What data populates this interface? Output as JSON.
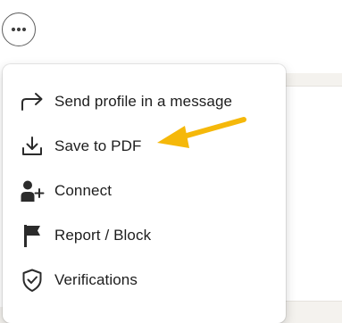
{
  "more_button": {
    "icon": "more-horizontal-icon"
  },
  "menu": {
    "items": [
      {
        "label": "Send profile in a message",
        "icon": "share-arrow-icon"
      },
      {
        "label": "Save to PDF",
        "icon": "download-icon"
      },
      {
        "label": "Connect",
        "icon": "add-person-icon"
      },
      {
        "label": "Report / Block",
        "icon": "flag-icon"
      },
      {
        "label": "Verifications",
        "icon": "shield-check-icon"
      }
    ]
  },
  "annotation": {
    "color": "#f5b80a"
  }
}
